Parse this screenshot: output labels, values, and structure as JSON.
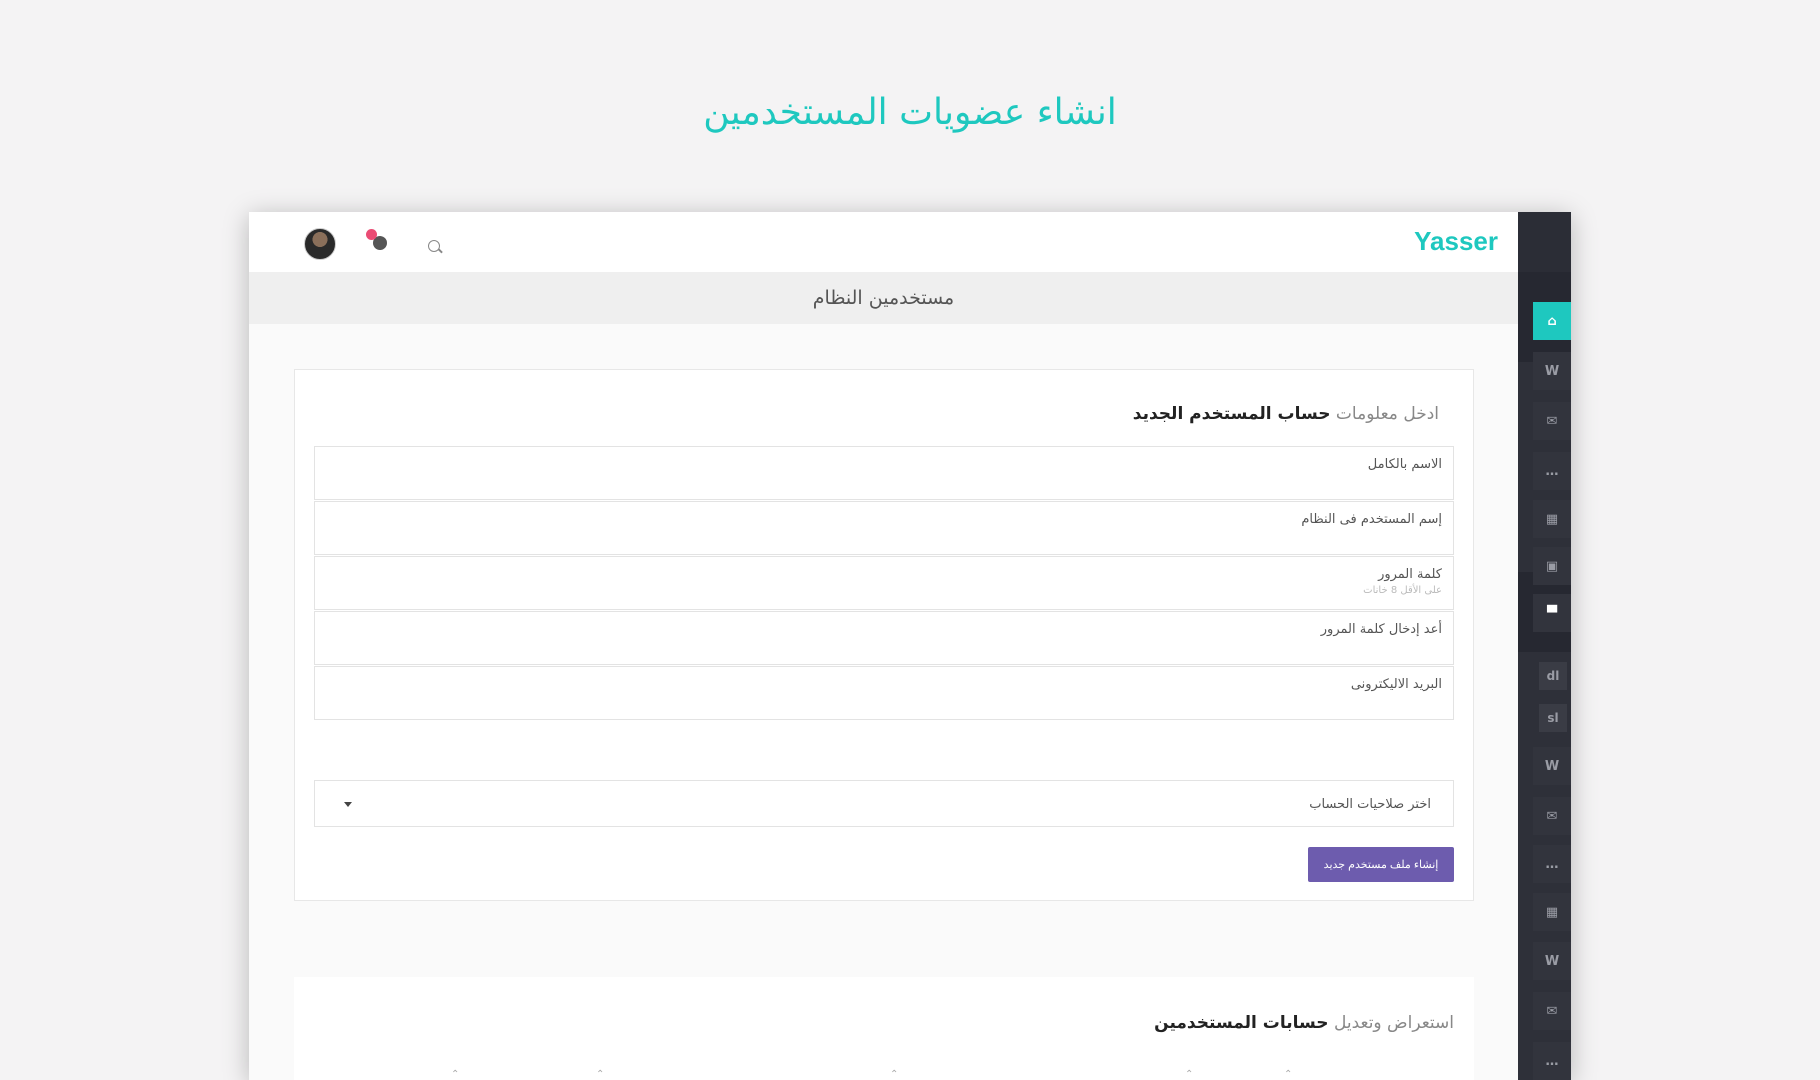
{
  "page_heading": "انشاء عضويات المستخدمين",
  "topbar": {
    "brand": "Yasser"
  },
  "subbar": {
    "title": "مستخدمين النظام"
  },
  "form": {
    "title_prefix": "ادخل معلومات",
    "title_bold": "حساب المستخدم الجديد",
    "fields": [
      {
        "label": "الاسم بالكامل",
        "hint": ""
      },
      {
        "label": "إسم المستخدم فى النظام",
        "hint": ""
      },
      {
        "label": "كلمة المرور",
        "hint": "على الأقل 8 خانات"
      },
      {
        "label": "أعد إدخال كلمة المرور",
        "hint": ""
      },
      {
        "label": "البريد الاليكترونى",
        "hint": ""
      }
    ],
    "select_label": "اختر صلاحيات الحساب",
    "submit_label": "إنشاء ملف مستخدم جديد"
  },
  "list_section": {
    "title_prefix": "استعراض وتعديل",
    "title_bold": "حسابات المستخدمين"
  },
  "sidebar": {
    "items": [
      {
        "icon": "home-icon",
        "glyph": "⌂"
      },
      {
        "icon": "w-icon",
        "glyph": "W"
      },
      {
        "icon": "mail-icon",
        "glyph": "✉"
      },
      {
        "icon": "chat-icon",
        "glyph": "…"
      },
      {
        "icon": "calendar-icon",
        "glyph": "▦"
      },
      {
        "icon": "media-icon",
        "glyph": "▣"
      },
      {
        "icon": "layout-icon",
        "glyph": "▀"
      },
      {
        "icon": "dl-icon",
        "glyph": "dl"
      },
      {
        "icon": "sl-icon",
        "glyph": "sl"
      },
      {
        "icon": "w-icon",
        "glyph": "W"
      },
      {
        "icon": "mail-icon",
        "glyph": "✉"
      },
      {
        "icon": "chat-icon",
        "glyph": "…"
      },
      {
        "icon": "calendar-icon",
        "glyph": "▦"
      },
      {
        "icon": "w-icon",
        "glyph": "W"
      },
      {
        "icon": "mail-icon",
        "glyph": "✉"
      },
      {
        "icon": "chat-icon",
        "glyph": "…"
      }
    ]
  },
  "colors": {
    "accent": "#1ec8bf",
    "button": "#6d5cae",
    "sidebar": "#262831",
    "notification": "#ea4c74"
  }
}
